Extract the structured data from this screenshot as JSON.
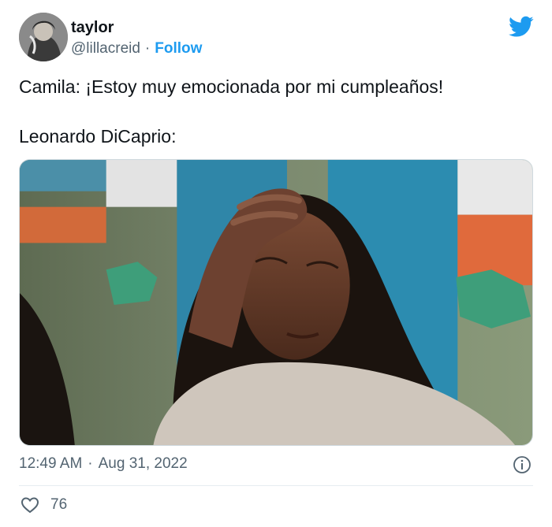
{
  "author": {
    "name": "taylor",
    "handle": "@lillacreid",
    "separator": "·",
    "follow_label": "Follow"
  },
  "tweet": {
    "line1": "Camila: ¡Estoy muy emocionada por mi cumpleaños!",
    "line2": "Leonardo DiCaprio:"
  },
  "meta": {
    "time": "12:49 AM",
    "separator": "·",
    "date": "Aug 31, 2022"
  },
  "engagement": {
    "likes": "76"
  },
  "icons": {
    "brand": "twitter-bird-icon",
    "info": "info-icon",
    "like": "heart-icon"
  },
  "colors": {
    "accent": "#1d9bf0",
    "text": "#0f1419",
    "secondary": "#536471"
  }
}
